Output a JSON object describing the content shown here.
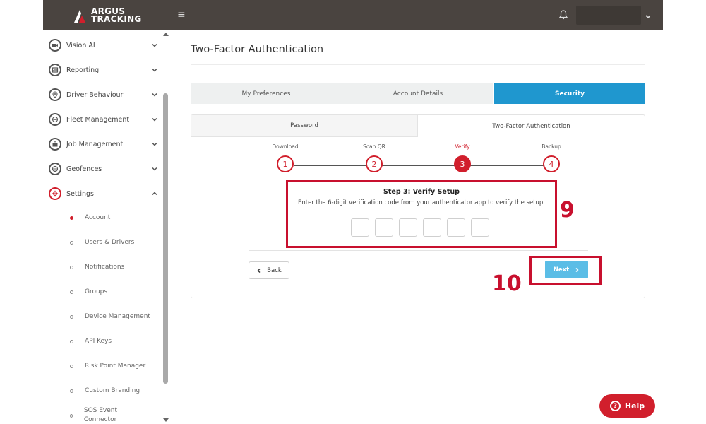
{
  "header": {
    "logo_line1": "ARGUS",
    "logo_line2": "TRACKING",
    "menu_icon": "hamburger-icon",
    "bell_icon": "bell-icon",
    "account_caret_icon": "chevron-down-icon"
  },
  "sidebar": {
    "items": [
      {
        "label": "Vision AI",
        "icon": "camera-icon",
        "expanded": false
      },
      {
        "label": "Reporting",
        "icon": "report-icon",
        "expanded": false
      },
      {
        "label": "Driver Behaviour",
        "icon": "location-pin-icon",
        "expanded": false
      },
      {
        "label": "Fleet Management",
        "icon": "steering-icon",
        "expanded": false
      },
      {
        "label": "Job Management",
        "icon": "briefcase-icon",
        "expanded": false
      },
      {
        "label": "Geofences",
        "icon": "globe-icon",
        "expanded": false
      },
      {
        "label": "Settings",
        "icon": "gear-icon",
        "expanded": true
      }
    ],
    "settings_sub": [
      {
        "label": "Account",
        "active": true
      },
      {
        "label": "Users & Drivers",
        "active": false
      },
      {
        "label": "Notifications",
        "active": false
      },
      {
        "label": "Groups",
        "active": false
      },
      {
        "label": "Device Management",
        "active": false
      },
      {
        "label": "API Keys",
        "active": false
      },
      {
        "label": "Risk Point Manager",
        "active": false
      },
      {
        "label": "Custom Branding",
        "active": false
      },
      {
        "label": "SOS Event Connector",
        "active": false
      }
    ]
  },
  "main": {
    "title": "Two-Factor Authentication",
    "tabs": [
      {
        "label": "My Preferences",
        "active": false
      },
      {
        "label": "Account Details",
        "active": false
      },
      {
        "label": "Security",
        "active": true
      }
    ],
    "sub_tabs": [
      {
        "label": "Password",
        "active": false
      },
      {
        "label": "Two-Factor Authentication",
        "active": true
      }
    ],
    "steps": [
      {
        "label": "Download",
        "number": "1",
        "active": false
      },
      {
        "label": "Scan QR",
        "number": "2",
        "active": false
      },
      {
        "label": "Verify",
        "number": "3",
        "active": true
      },
      {
        "label": "Backup",
        "number": "4",
        "active": false
      }
    ],
    "verify": {
      "title": "Step 3: Verify Setup",
      "description": "Enter the 6-digit verification code from your authenticator app to verify the setup.",
      "digits": [
        "",
        "",
        "",
        "",
        "",
        ""
      ]
    },
    "back_label": "Back",
    "next_label": "Next"
  },
  "annotations": {
    "verify_marker": "9",
    "next_marker": "10"
  },
  "help_label": "Help",
  "colors": {
    "brand_red": "#d11f2c",
    "accent_blue": "#1f97cf",
    "next_blue": "#5bbde6",
    "topbar": "#4a4440",
    "annotation_red": "#c8102e"
  }
}
